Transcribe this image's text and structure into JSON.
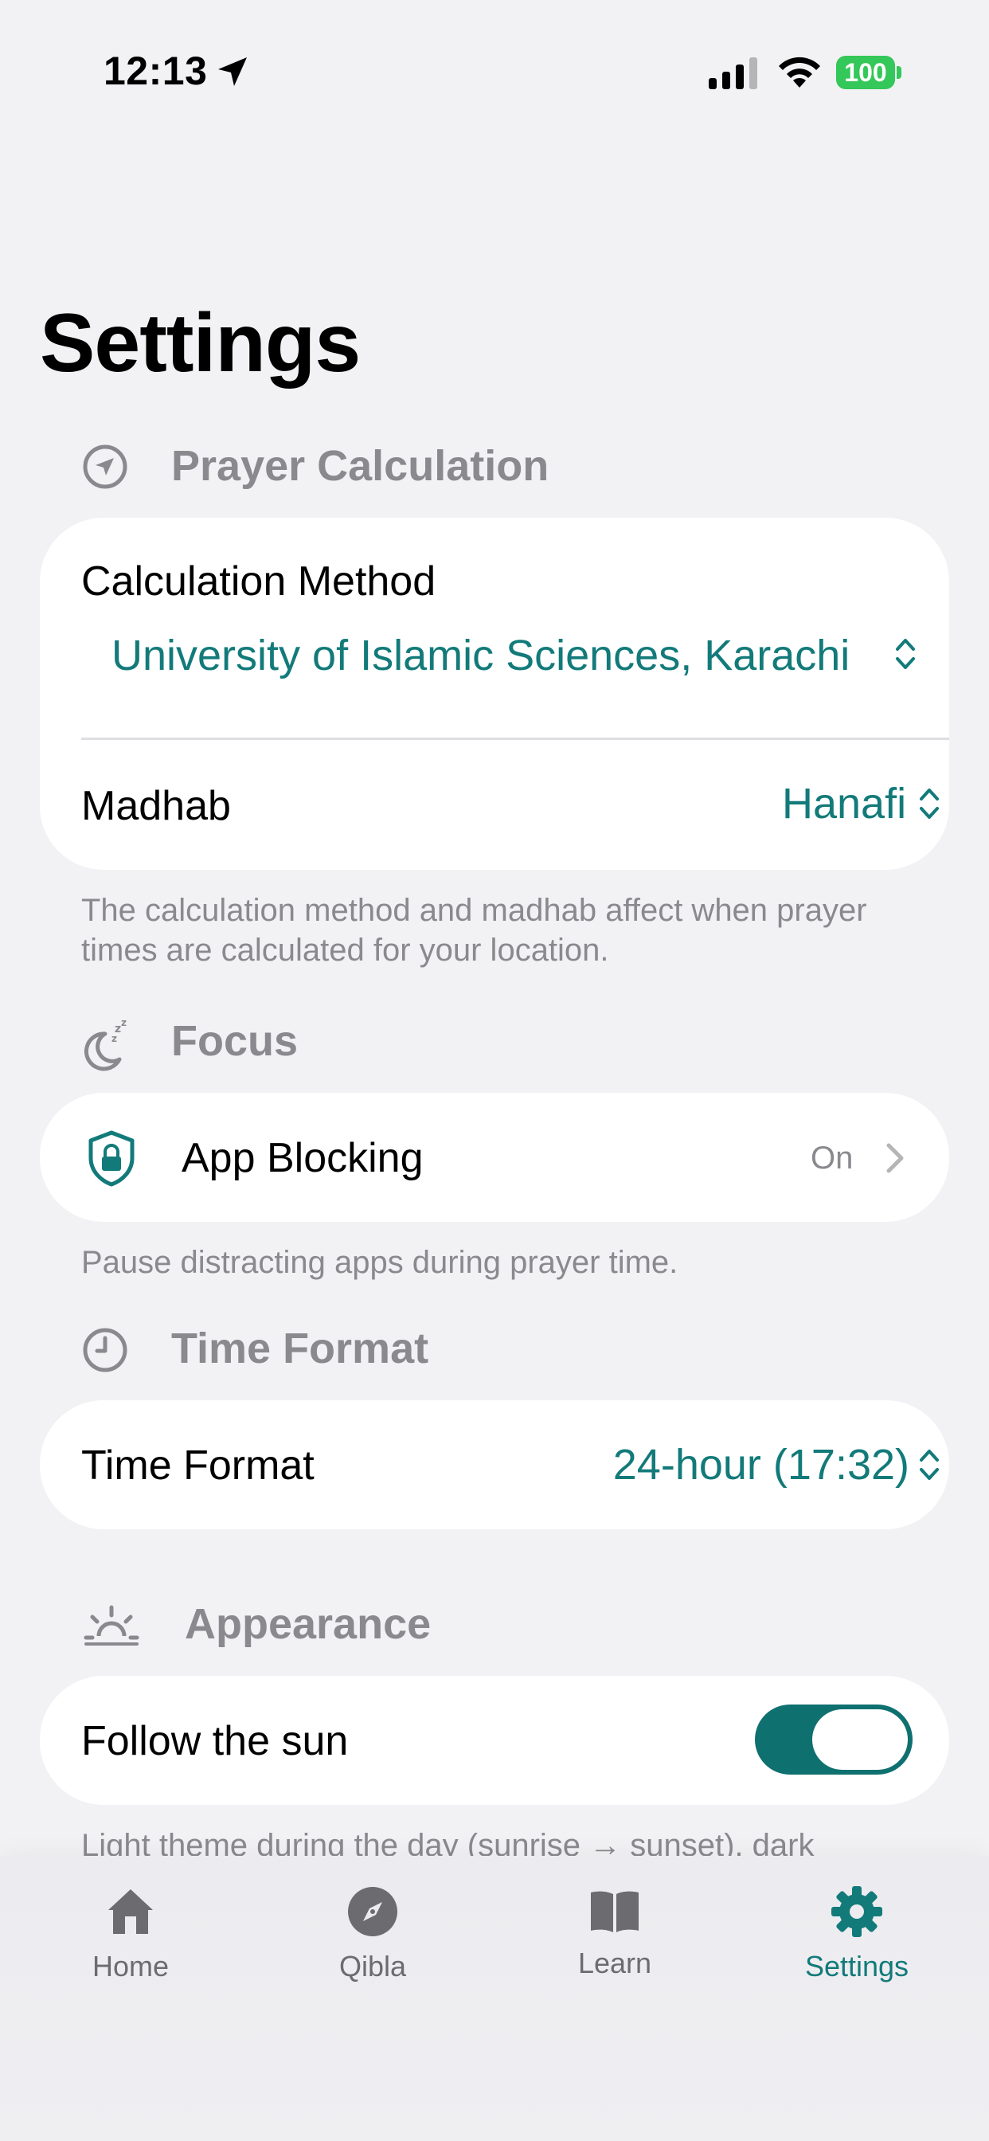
{
  "status_bar": {
    "time": "12:13",
    "battery": "100"
  },
  "page": {
    "title": "Settings"
  },
  "sections": {
    "prayer_calculation": {
      "header": "Prayer Calculation",
      "calculation_method_label": "Calculation Method",
      "calculation_method_value": "University of Islamic Sciences, Karachi",
      "madhab_label": "Madhab",
      "madhab_value": "Hanafi",
      "footnote": "The calculation method and madhab affect when prayer times are calculated for your location."
    },
    "focus": {
      "header": "Focus",
      "app_blocking_label": "App Blocking",
      "app_blocking_value": "On",
      "footnote": "Pause distracting apps during prayer time."
    },
    "time_format": {
      "header": "Time Format",
      "label": "Time Format",
      "value": "24-hour (17:32)"
    },
    "appearance": {
      "header": "Appearance",
      "follow_sun_label": "Follow the sun",
      "follow_sun_enabled": true,
      "footnote": "Light theme during the day (sunrise → sunset), dark"
    }
  },
  "tabbar": {
    "items": [
      {
        "label": "Home",
        "icon": "house-icon"
      },
      {
        "label": "Qibla",
        "icon": "compass-icon"
      },
      {
        "label": "Learn",
        "icon": "book-icon"
      },
      {
        "label": "Settings",
        "icon": "gear-icon"
      }
    ],
    "active": "Settings"
  },
  "colors": {
    "accent": "#137a7a",
    "battery": "#34c759",
    "background": "#f2f2f5"
  }
}
